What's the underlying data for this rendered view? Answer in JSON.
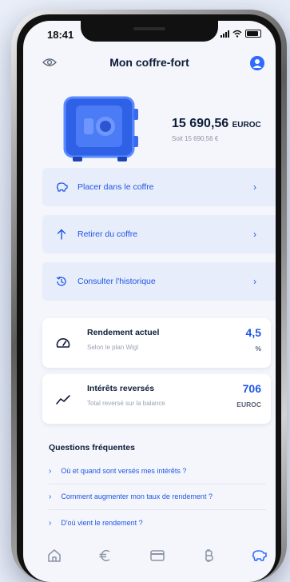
{
  "status": {
    "time": "18:41"
  },
  "header": {
    "title": "Mon coffre-fort"
  },
  "balance": {
    "amount": "15 690,56",
    "currency": "EUROC",
    "subtitle": "Soit 15 690,56 €"
  },
  "actions": [
    {
      "label": "Placer dans le coffre",
      "icon": "piggy-bank-icon"
    },
    {
      "label": "Retirer du coffre",
      "icon": "arrow-up-icon"
    },
    {
      "label": "Consulter l'historique",
      "icon": "history-icon"
    }
  ],
  "cards": [
    {
      "title": "Rendement actuel",
      "subtitle": "Selon le plan Wigl",
      "value": "4,5",
      "unit": "%",
      "icon": "speedometer-icon"
    },
    {
      "title": "Intérêts reversés",
      "subtitle": "Total reversé sur la balance",
      "value": "706",
      "unit": "EUROC",
      "icon": "trend-chart-icon"
    }
  ],
  "faq": {
    "title": "Questions fréquentes",
    "items": [
      "Où et quand sont versés mes intérêts ?",
      "Comment augmenter mon taux de rendement ?",
      "D'où vient le rendement ?"
    ]
  },
  "tabs": [
    {
      "name": "home-icon"
    },
    {
      "name": "euro-icon"
    },
    {
      "name": "card-icon"
    },
    {
      "name": "bitcoin-icon"
    },
    {
      "name": "piggy-bank-icon",
      "active": true
    }
  ],
  "colors": {
    "accent": "#2f6bff",
    "text": "#0e1c3a",
    "muted": "#9aa2b3"
  }
}
